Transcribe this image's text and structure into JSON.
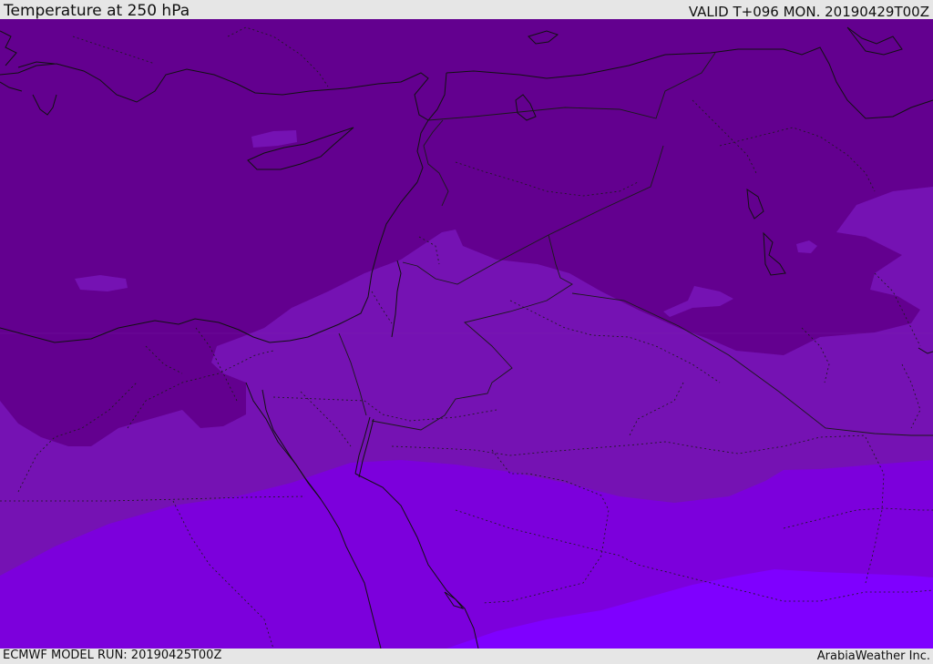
{
  "header": {
    "title": "Temperature at 250 hPa",
    "valid": "VALID T+096 MON. 20190429T00Z"
  },
  "footer": {
    "model_run": "ECMWF MODEL RUN: 20190425T00Z",
    "credit": "ArabiaWeather Inc."
  },
  "colors": {
    "band_coldest": "#63008f",
    "band_cold": "#7512b3",
    "band_mid": "#7c00dc",
    "band_warm": "#7f00ff",
    "coastline": "#111111",
    "border": "#1a1a1a"
  }
}
